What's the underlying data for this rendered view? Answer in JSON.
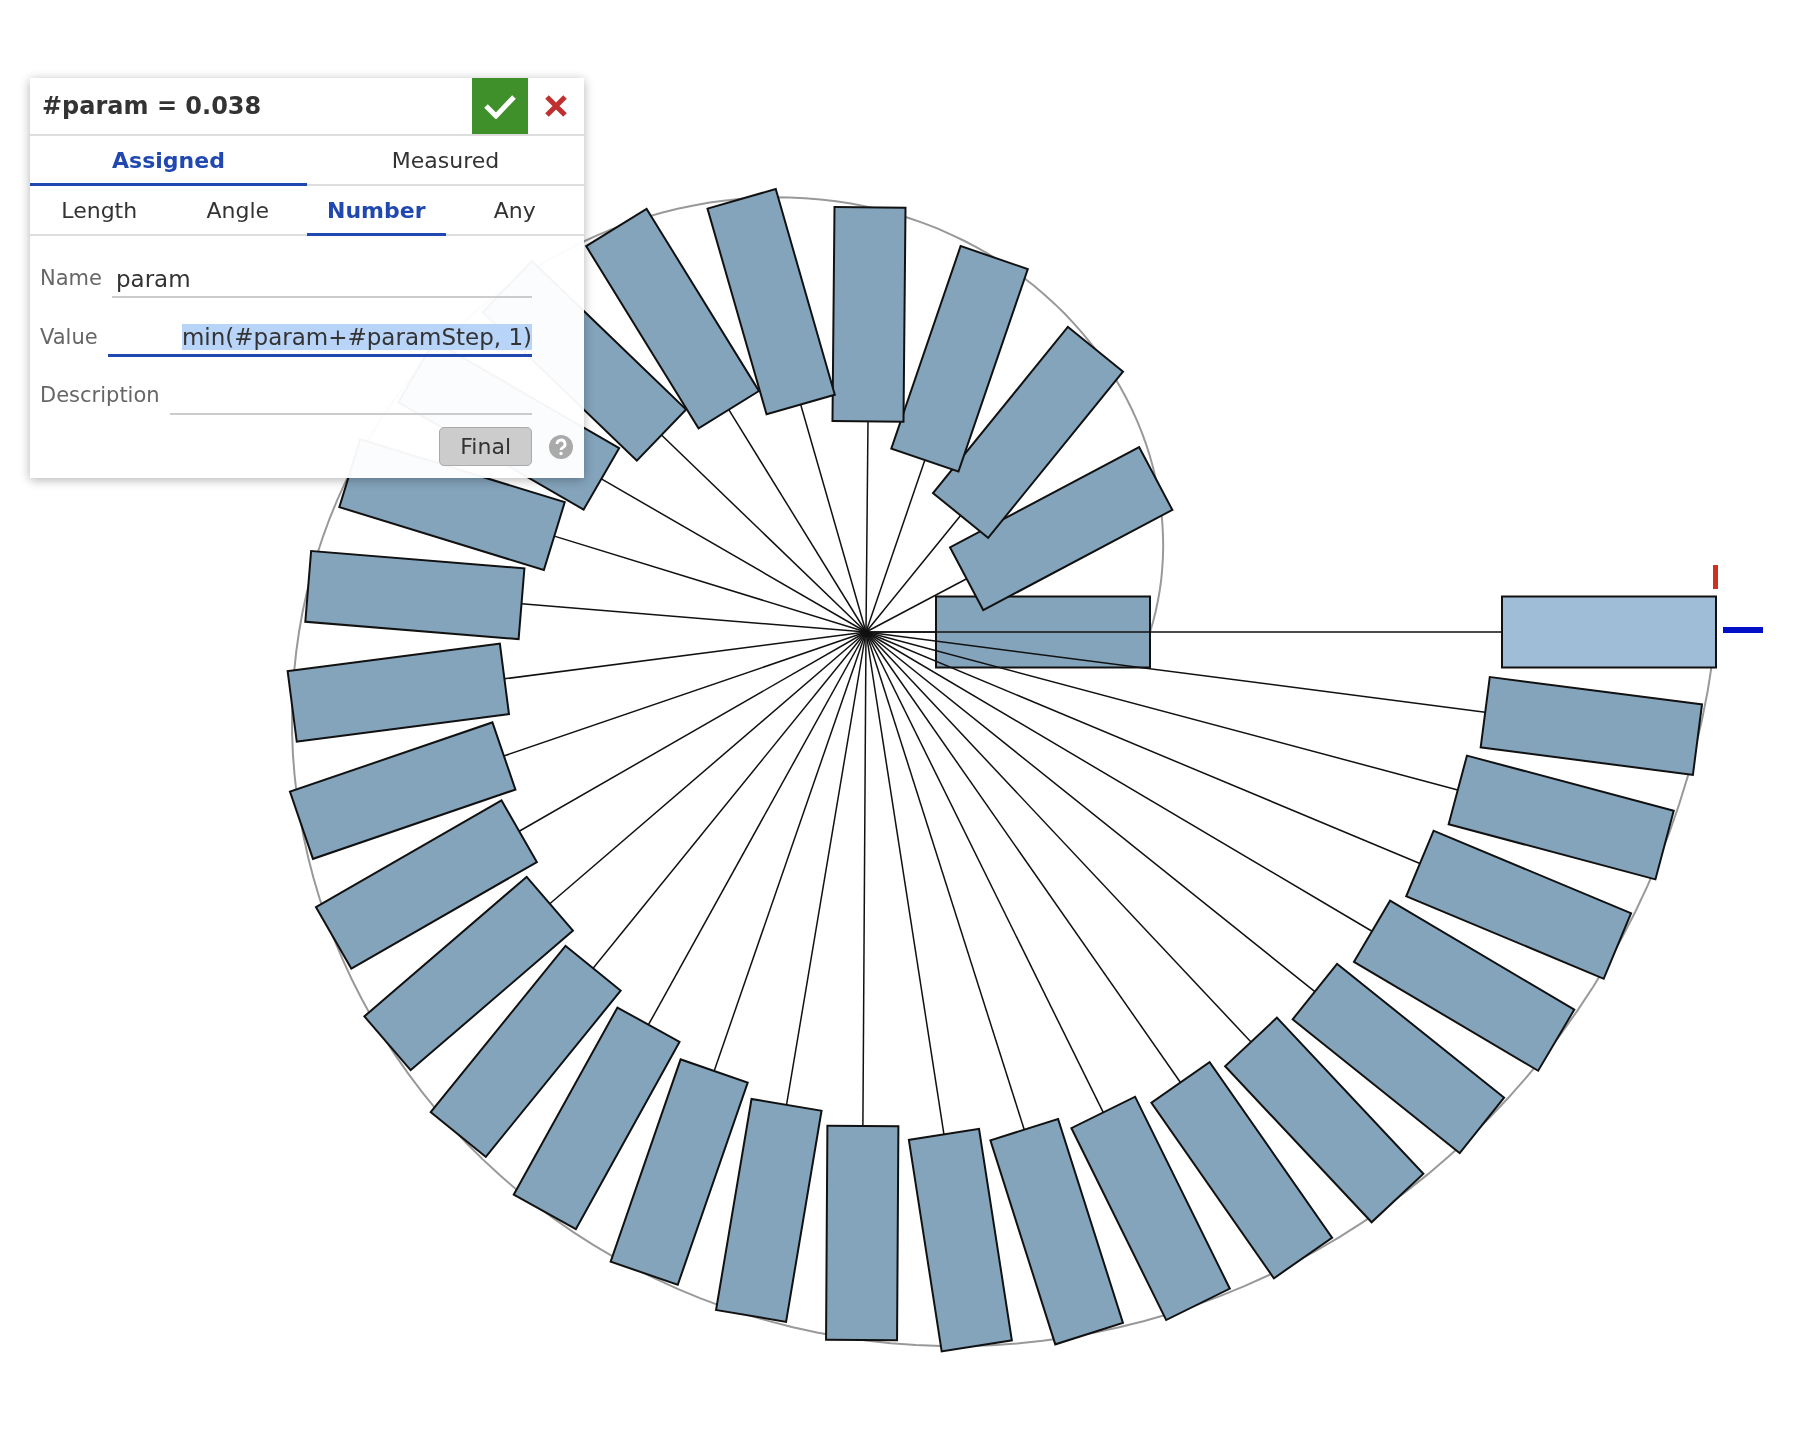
{
  "dialog": {
    "title": "#param = 0.038",
    "mode_tabs": [
      {
        "label": "Assigned",
        "selected": true
      },
      {
        "label": "Measured",
        "selected": false
      }
    ],
    "type_tabs": [
      {
        "label": "Length",
        "selected": false
      },
      {
        "label": "Angle",
        "selected": false
      },
      {
        "label": "Number",
        "selected": true
      },
      {
        "label": "Any",
        "selected": false
      }
    ],
    "fields": [
      {
        "label": "Name",
        "value": "param",
        "focused": false
      },
      {
        "label": "Value",
        "value": "min(#param+#paramStep, 1)",
        "focused": true
      },
      {
        "label": "Description",
        "focused": false
      }
    ],
    "final_button": "Final"
  }
}
